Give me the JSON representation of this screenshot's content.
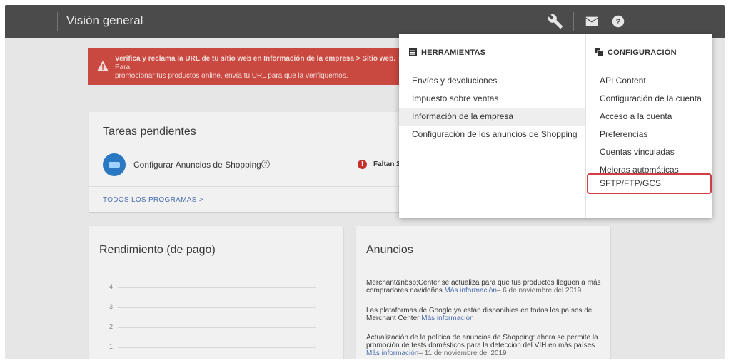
{
  "header": {
    "title": "Visión general",
    "icons": [
      "wrench-icon",
      "mail-icon",
      "help-icon"
    ]
  },
  "alert": {
    "bold_text": "Verifica y reclama la URL de tu sitio web en Información de la empresa > Sitio web.",
    "text_tail": " Para",
    "line2": "promocionar tus productos online, envía tu URL para que la verifiquemos."
  },
  "tasks": {
    "title": "Tareas pendientes",
    "item_label": "Configurar Anuncios de Shopping",
    "status_text": "Faltan 2",
    "all_programs_link": "TODOS LOS PROGRAMAS  >"
  },
  "performance": {
    "title": "Rendimiento (de pago)",
    "y_ticks": [
      "4",
      "3",
      "2",
      "1"
    ]
  },
  "announcements": {
    "title": "Anuncios",
    "items": [
      {
        "text": "Merchant&nbsp;Center se actualiza para que tus productos lleguen a más compradores navideños ",
        "more": "Más información",
        "date": "– 6 de noviembre del 2019"
      },
      {
        "text": "Las plataformas de Google ya están disponibles en todos los países de Merchant Center ",
        "more": "Más información",
        "date": ""
      },
      {
        "text": "Actualización de la política de anuncios de Shopping: ahora se permite la promoción de tests domésticos para la detección del VIH en más países ",
        "more": "Más información",
        "date": "– 11 de noviembre del 2019"
      }
    ]
  },
  "menu": {
    "tools": {
      "heading": "HERRAMIENTAS",
      "items": [
        "Envíos y devoluciones",
        "Impuesto sobre ventas",
        "Información de la empresa",
        "Configuración de los anuncios de Shopping"
      ],
      "active_index": 2
    },
    "config": {
      "heading": "CONFIGURACIÓN",
      "items": [
        "API Content",
        "Configuración de la cuenta",
        "Acceso a la cuenta",
        "Preferencias",
        "Cuentas vinculadas",
        "Mejoras automáticas",
        "SFTP/FTP/GCS"
      ],
      "highlighted_index": 6
    }
  },
  "colors": {
    "appbar": "#4b4b4b",
    "alert": "#c9483f",
    "link": "#4b6fb0",
    "highlight_border": "#d23c45"
  }
}
